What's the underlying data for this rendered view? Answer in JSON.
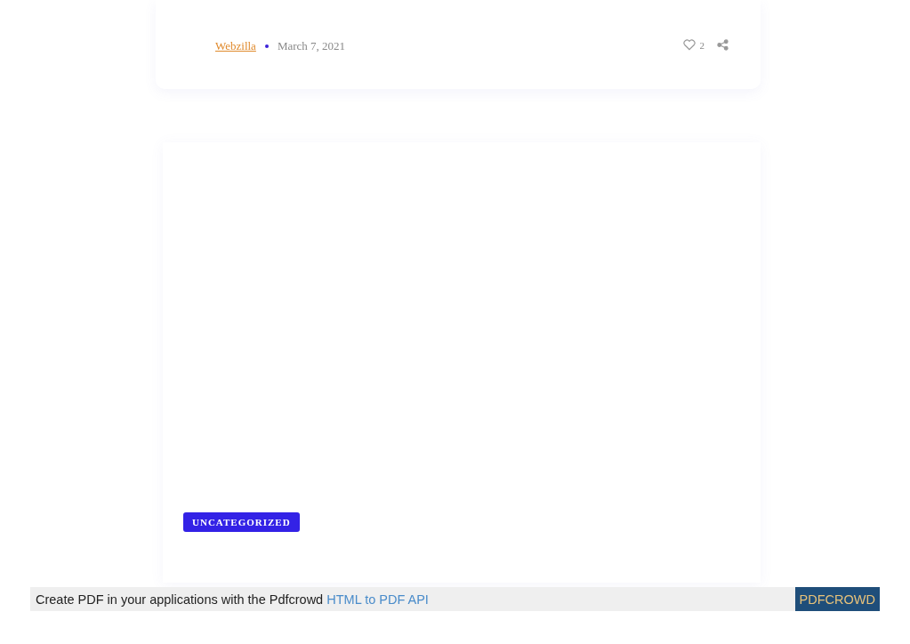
{
  "post_meta": {
    "author": "Webzilla",
    "date": "March 7, 2021",
    "likes": "2"
  },
  "post_card": {
    "category": "UNCATEGORIZED"
  },
  "footer_bar": {
    "text": "Create PDF in your applications with the Pdfcrowd",
    "link": "HTML to PDF API",
    "button": "PDFCROWD"
  }
}
